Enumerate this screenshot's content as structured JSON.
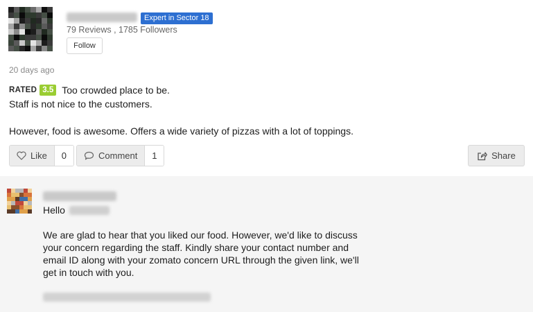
{
  "review": {
    "reviewer": {
      "badge": "Expert in Sector 18",
      "stats": "79 Reviews , 1785 Followers",
      "follow_label": "Follow"
    },
    "time_ago": "20 days ago",
    "rated_label": "RATED",
    "rating": "3.5",
    "rating_color": "#9acd32",
    "text_line1": "Too crowded place to be.",
    "text_line2": "Staff is not nice to the customers.",
    "text_line3": "However, food is awesome. Offers a wide variety of pizzas with a lot of toppings.",
    "actions": {
      "like_label": "Like",
      "like_count": "0",
      "comment_label": "Comment",
      "comment_count": "1",
      "share_label": "Share"
    }
  },
  "reply": {
    "greeting": "Hello",
    "lines": [
      "We are glad to hear that you liked our food. However, we'd like to discuss",
      "your concern regarding the staff. Kindly share your contact number and",
      "email ID along with your zomato concern URL through the given link, we'll",
      "get in touch with you."
    ]
  },
  "colors": {
    "badge": "#2d6fd1",
    "reply_background": "#f5f5f5",
    "button_background": "#ececec"
  },
  "icons": [
    "heart-icon",
    "comment-bubble-icon",
    "share-icon"
  ]
}
